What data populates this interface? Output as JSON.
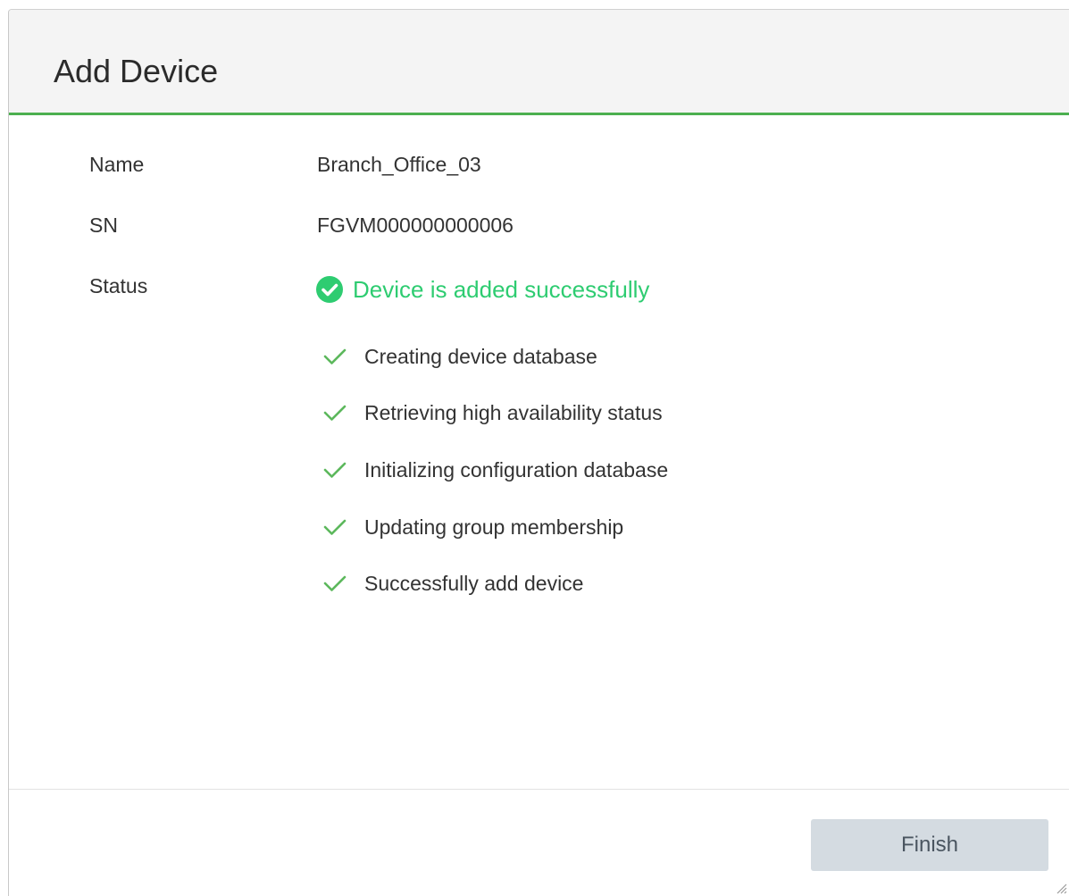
{
  "dialog": {
    "title": "Add Device"
  },
  "fields": {
    "name_label": "Name",
    "name_value": "Branch_Office_03",
    "sn_label": "SN",
    "sn_value": "FGVM000000000006",
    "status_label": "Status",
    "status_value": "Device is added successfully",
    "status_icon": "check-circle-icon"
  },
  "steps": [
    {
      "label": "Creating device database",
      "icon": "check-icon"
    },
    {
      "label": "Retrieving high availability status",
      "icon": "check-icon"
    },
    {
      "label": "Initializing configuration database",
      "icon": "check-icon"
    },
    {
      "label": "Updating group membership",
      "icon": "check-icon"
    },
    {
      "label": "Successfully add device",
      "icon": "check-icon"
    }
  ],
  "footer": {
    "finish_label": "Finish"
  },
  "colors": {
    "accent_green": "#4caf50",
    "success_text": "#2ecc71",
    "button_bg": "#d4dbe1"
  }
}
